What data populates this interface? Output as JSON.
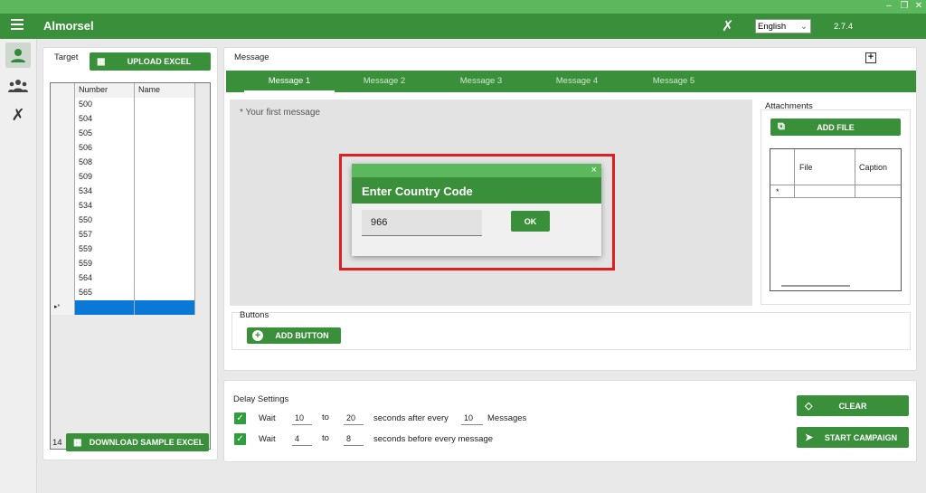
{
  "app": {
    "title": "Almorsel",
    "version": "2.7.4",
    "language": "English"
  },
  "target": {
    "label": "Target",
    "upload_label": "UPLOAD EXCEL",
    "download_label": "DOWNLOAD SAMPLE EXCEL",
    "count": "14",
    "columns": [
      "Number",
      "Name"
    ],
    "rows": [
      {
        "number": "500",
        "name": ""
      },
      {
        "number": "504",
        "name": ""
      },
      {
        "number": "505",
        "name": ""
      },
      {
        "number": "506",
        "name": ""
      },
      {
        "number": "508",
        "name": ""
      },
      {
        "number": "509",
        "name": ""
      },
      {
        "number": "534",
        "name": ""
      },
      {
        "number": "534",
        "name": ""
      },
      {
        "number": "550",
        "name": ""
      },
      {
        "number": "557",
        "name": ""
      },
      {
        "number": "559",
        "name": ""
      },
      {
        "number": "559",
        "name": ""
      },
      {
        "number": "564",
        "name": ""
      },
      {
        "number": "565",
        "name": ""
      }
    ]
  },
  "message": {
    "label": "Message",
    "tabs": [
      "Message 1",
      "Message 2",
      "Message 3",
      "Message 4",
      "Message 5"
    ],
    "placeholder": "* Your first message",
    "buttons_label": "Buttons",
    "add_button_label": "ADD BUTTON"
  },
  "attachments": {
    "label": "Attachments",
    "add_file_label": "ADD FILE",
    "columns": [
      "File",
      "Caption"
    ],
    "new_row_marker": "*"
  },
  "dialog": {
    "title": "Enter Country Code",
    "value": "966",
    "ok_label": "OK",
    "close": "×"
  },
  "delay": {
    "label": "Delay Settings",
    "row1": {
      "wait": "Wait",
      "from": "10",
      "to_label": "to",
      "to": "20",
      "text": "seconds after every",
      "count": "10",
      "suffix": "Messages"
    },
    "row2": {
      "wait": "Wait",
      "from": "4",
      "to_label": "to",
      "to": "8",
      "text": "seconds before every message"
    }
  },
  "actions": {
    "clear_label": "CLEAR",
    "start_label": "START CAMPAIGN"
  },
  "colors": {
    "primary": "#3a8f3a",
    "light": "#5cb85c",
    "highlight": "#e02020",
    "selection": "#0a78d7"
  }
}
